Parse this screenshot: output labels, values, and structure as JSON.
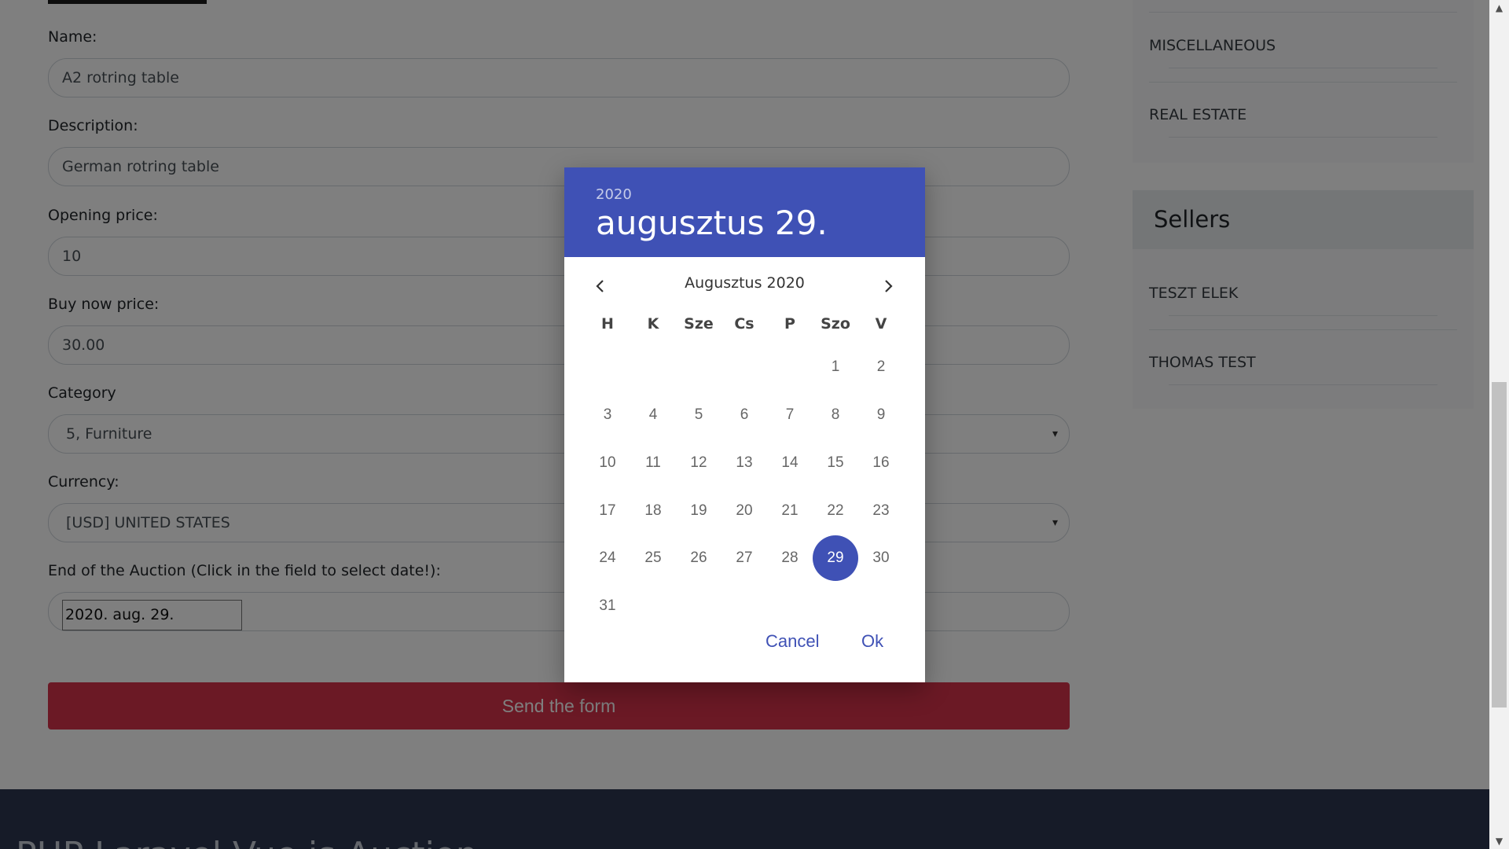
{
  "form": {
    "name_label": "Name:",
    "name_value": "A2 rotring table",
    "description_label": "Description:",
    "description_value": "German rotring table",
    "opening_price_label": "Opening price:",
    "opening_price_value": "10",
    "buy_now_label": "Buy now price:",
    "buy_now_value": "30.00",
    "category_label": "Category",
    "category_value": "5, Furniture",
    "currency_label": "Currency:",
    "currency_value": "[USD] UNITED STATES",
    "end_label": "End of the Auction (Click in the field to select date!):",
    "end_value": "2020. aug. 29.",
    "send_label": "Send the form",
    "select_arrow": "▾"
  },
  "sidebar": {
    "categories": [
      "MISCELLANEOUS",
      "REAL ESTATE"
    ],
    "sellers_title": "Sellers",
    "sellers": [
      "TESZT ELEK",
      "THOMAS TEST"
    ]
  },
  "footer": {
    "title": "PHP Laravel Vue.js Auction"
  },
  "datepicker": {
    "year": "2020",
    "selected_date": "augusztus 29.",
    "month_label": "Augusztus 2020",
    "weekdays": [
      "H",
      "K",
      "Sze",
      "Cs",
      "P",
      "Szo",
      "V"
    ],
    "days": [
      "1",
      "2",
      "3",
      "4",
      "5",
      "6",
      "7",
      "8",
      "9",
      "10",
      "11",
      "12",
      "13",
      "14",
      "15",
      "16",
      "17",
      "18",
      "19",
      "20",
      "21",
      "22",
      "23",
      "24",
      "25",
      "26",
      "27",
      "28",
      "29",
      "30",
      "31"
    ],
    "selected_day": "29",
    "cancel_label": "Cancel",
    "ok_label": "Ok",
    "accent_color": "#3f51b5"
  },
  "scrollbar": {
    "up_arrow": "▲",
    "down_arrow": "▼"
  }
}
